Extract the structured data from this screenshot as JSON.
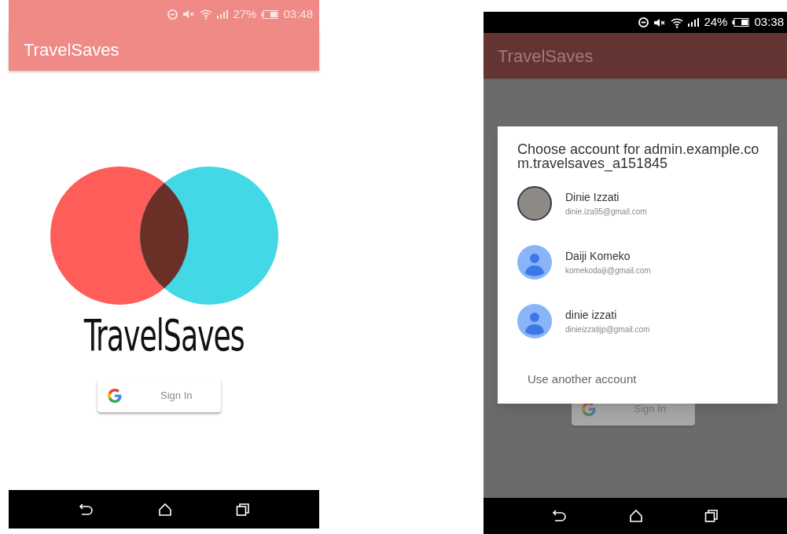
{
  "screens": [
    {
      "status_bar": {
        "battery": "27%",
        "time": "03:48"
      },
      "app_bar": {
        "title": "TravelSaves"
      },
      "logo": {
        "wordmark": "TravelSaves"
      },
      "sign_in_button": {
        "label": "Sign In"
      }
    },
    {
      "status_bar": {
        "battery": "24%",
        "time": "03:38"
      },
      "app_bar": {
        "title": "TravelSaves"
      },
      "sign_in_button": {
        "label": "Sign In"
      },
      "dialog": {
        "title": "Choose account for admin.example.com.travelsaves_a151845",
        "accounts": [
          {
            "name": "Dinie Izzati",
            "email": "dinie.iza95@gmail.com",
            "kind": "photo"
          },
          {
            "name": "Daiji Komeko",
            "email": "komekodaiji@gmail.com",
            "kind": "default"
          },
          {
            "name": "dinie izzati",
            "email": "dinieizzatijp@gmail.com",
            "kind": "default"
          }
        ],
        "footer_action": "Use another account"
      }
    }
  ]
}
